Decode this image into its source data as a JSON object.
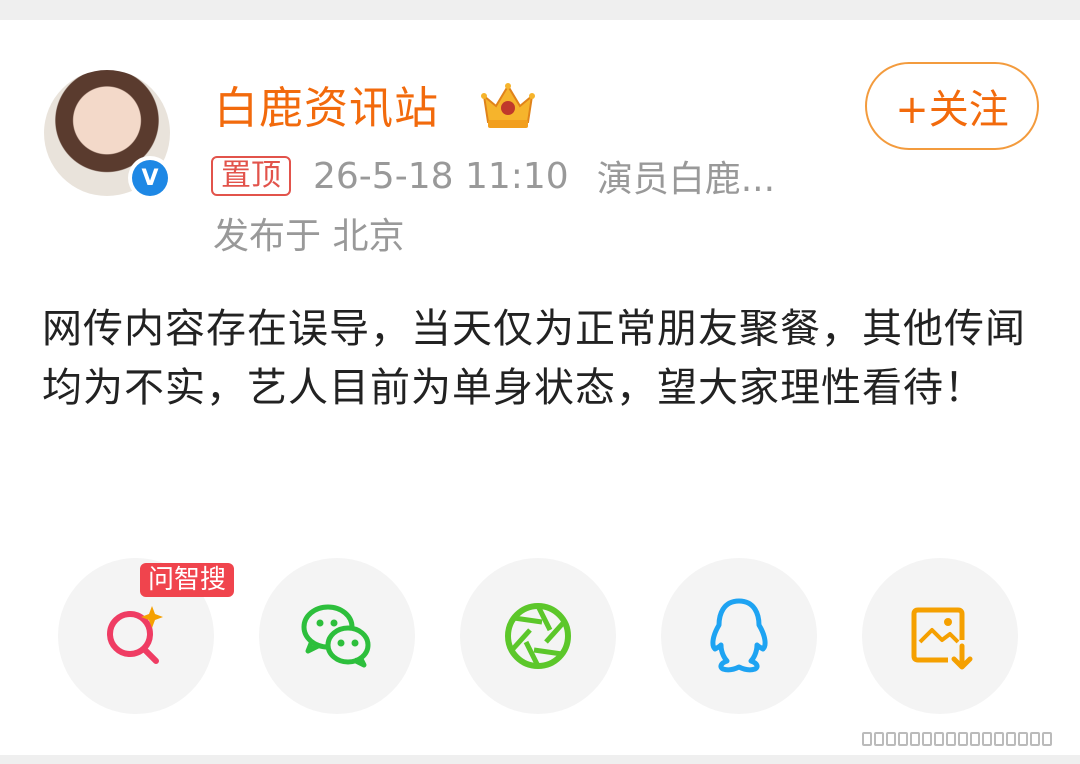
{
  "post": {
    "author": "白鹿资讯站",
    "follow_label": "+关注",
    "pin_label": "置顶",
    "timestamp": "26-5-18 11:10",
    "source": "演员白鹿...",
    "location": "发布于 北京",
    "text": "网传内容存在误导，当天仅为正常朋友聚餐，其他传闻均为不实，艺人目前为单身状态，望大家理性看待！",
    "verified_badge": "V"
  },
  "share": {
    "tag": "问智搜",
    "items": [
      {
        "icon": "zhisou-search-icon"
      },
      {
        "icon": "wechat-icon"
      },
      {
        "icon": "moments-icon"
      },
      {
        "icon": "qq-icon"
      },
      {
        "icon": "save-image-icon"
      }
    ]
  },
  "colors": {
    "brand_orange": "#f26a0c",
    "follow_border": "#f39b3d",
    "pin_red": "#e2534b",
    "wechat_green": "#2dbf3c",
    "moments_green": "#5cc72a",
    "qq_blue": "#1ea3f2",
    "save_orange": "#f5a000",
    "search_pink": "#ef3c63"
  }
}
